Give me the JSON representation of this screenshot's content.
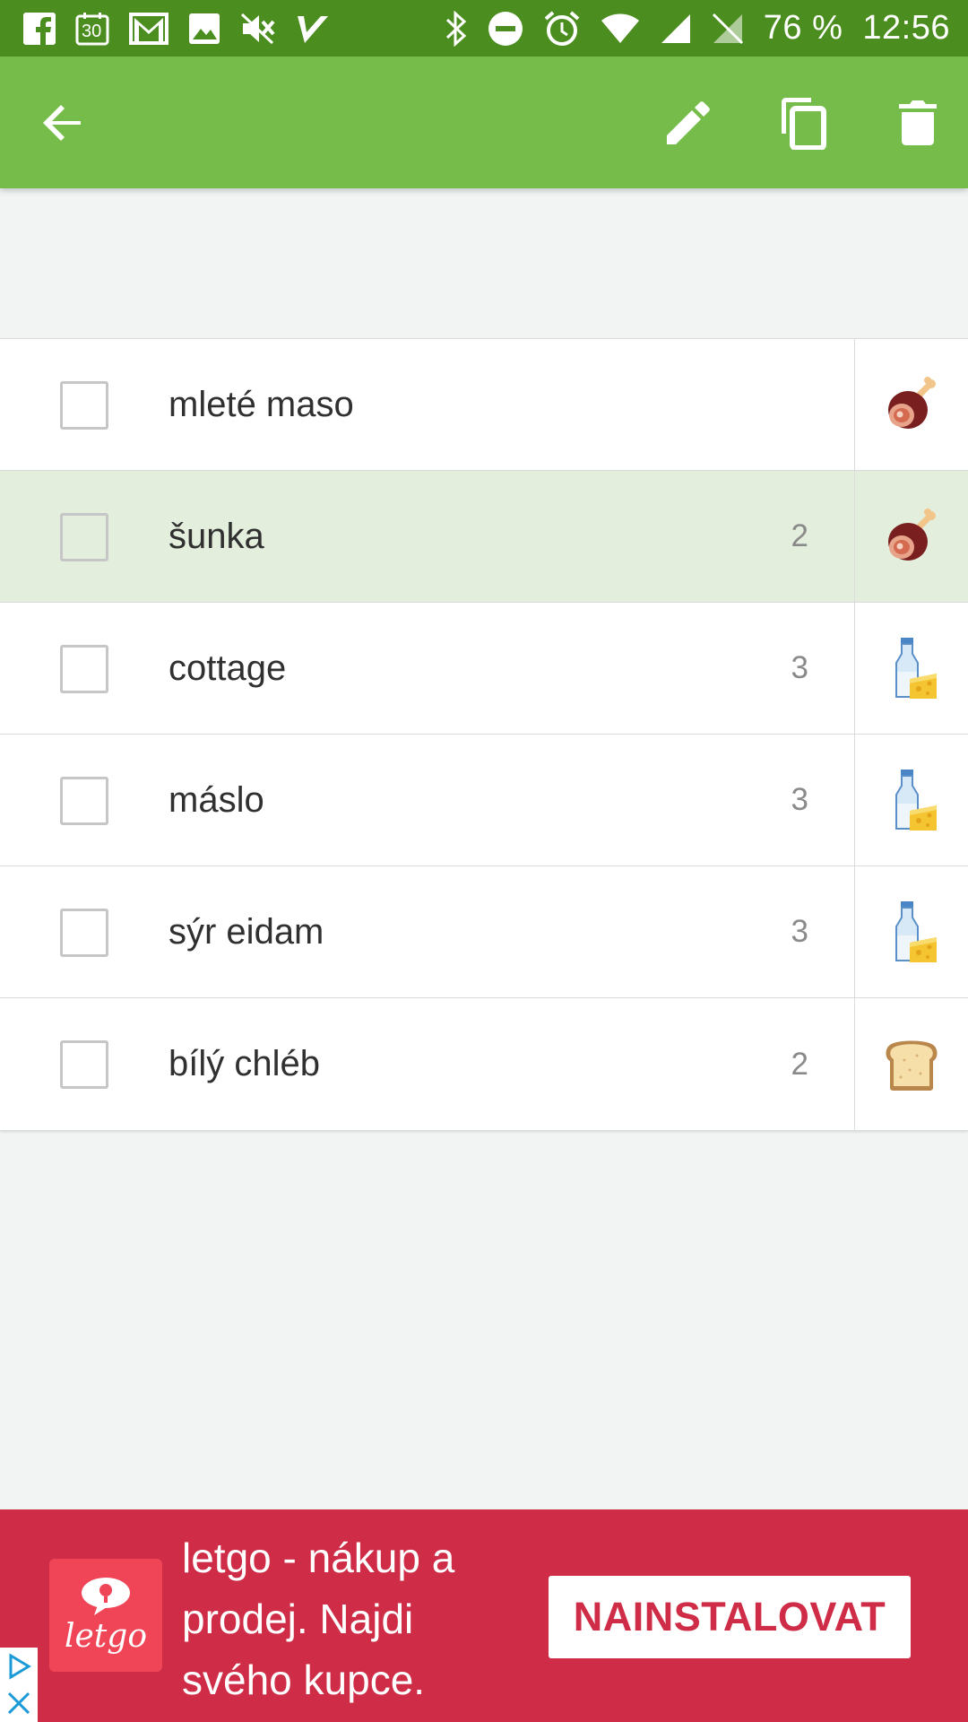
{
  "status_bar": {
    "left_icons": [
      "facebook-icon",
      "calendar-icon",
      "gmail-icon",
      "gallery-icon",
      "muted-icon",
      "tasks-icon"
    ],
    "calendar_day": "30",
    "right_icons": [
      "bluetooth-icon",
      "dnd-icon",
      "alarm-icon",
      "wifi-icon",
      "signal-icon",
      "no-signal-icon"
    ],
    "battery": "76 %",
    "time": "12:56"
  },
  "app_bar": {
    "back_icon": "arrow-back-icon",
    "actions": [
      "edit-icon",
      "copy-icon",
      "delete-icon"
    ]
  },
  "colors": {
    "status_bar": "#4b8e1f",
    "app_bar": "#76bc4a",
    "highlight_row": "#e4eedd",
    "ad_background": "#cf2d47",
    "ad_logo": "#ef4557"
  },
  "items": [
    {
      "name": "mleté maso",
      "qty": "",
      "category_icon": "ham-icon",
      "highlighted": false
    },
    {
      "name": "šunka",
      "qty": "2",
      "category_icon": "ham-icon",
      "highlighted": true
    },
    {
      "name": "cottage",
      "qty": "3",
      "category_icon": "milk-cheese-icon",
      "highlighted": false
    },
    {
      "name": "máslo",
      "qty": "3",
      "category_icon": "milk-cheese-icon",
      "highlighted": false
    },
    {
      "name": "sýr eidam",
      "qty": "3",
      "category_icon": "milk-cheese-icon",
      "highlighted": false
    },
    {
      "name": "bílý chléb",
      "qty": "2",
      "category_icon": "bread-icon",
      "highlighted": false
    }
  ],
  "ad": {
    "logo_text": "letgo",
    "text": "letgo - nákup a prodej. Najdi svého kupce.",
    "cta": "NAINSTALOVAT",
    "choices_icons": [
      "adchoices-icon",
      "close-icon"
    ]
  }
}
